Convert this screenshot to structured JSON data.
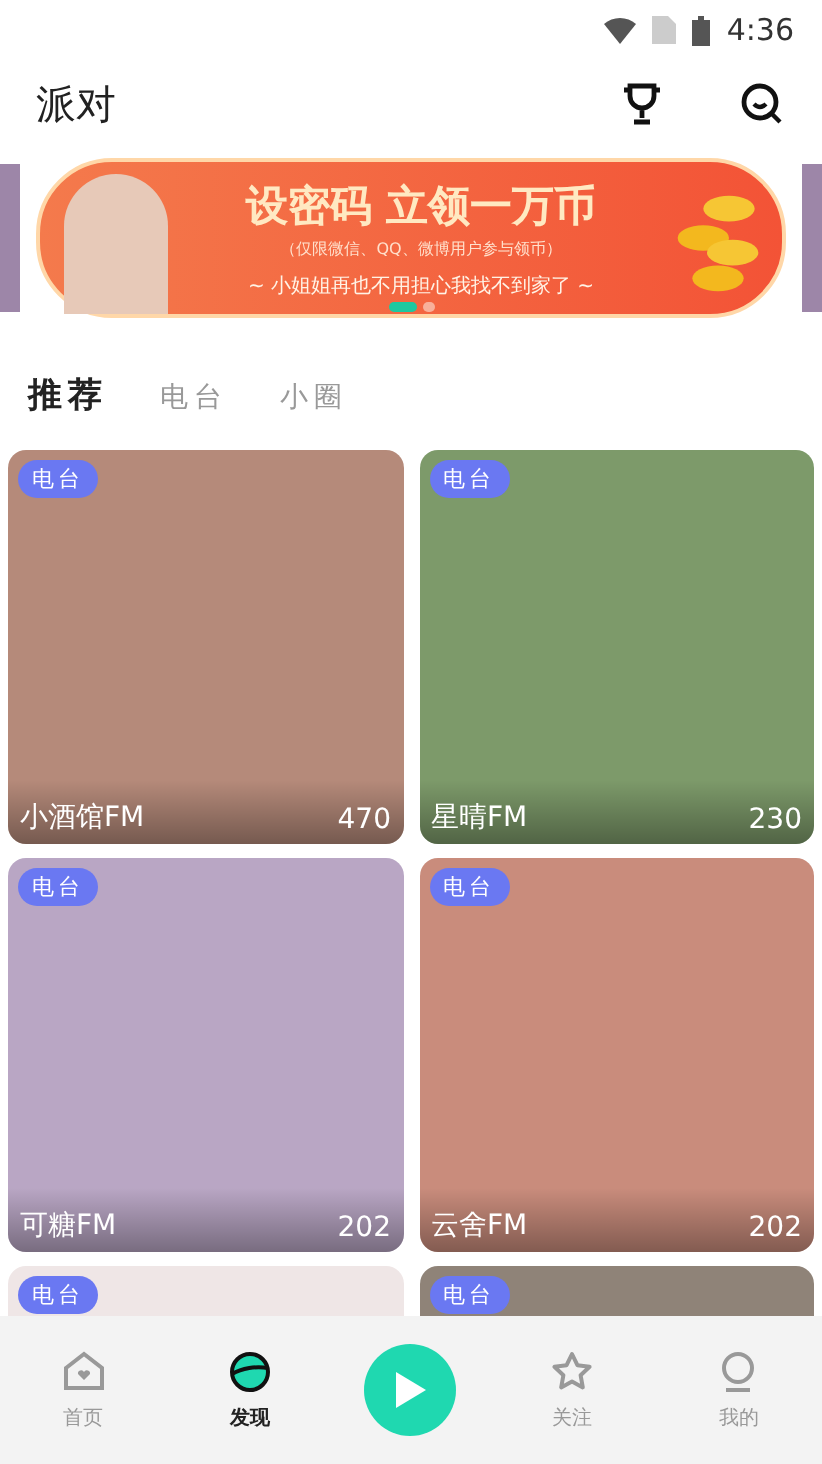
{
  "status_bar": {
    "time": "4:36"
  },
  "header": {
    "title": "派对"
  },
  "banner": {
    "headline": "设密码 立领一万币",
    "note": "（仅限微信、QQ、微博用户参与领币）",
    "slogan": "~ 小姐姐再也不用担心我找不到家了 ~",
    "pages": [
      {
        "selected": true
      },
      {
        "selected": false
      }
    ]
  },
  "tabs": [
    {
      "label": "推荐",
      "selected": true
    },
    {
      "label": "电台",
      "selected": false
    },
    {
      "label": "小圈",
      "selected": false
    }
  ],
  "cards": [
    {
      "badge": "电台",
      "name": "小酒馆FM",
      "count": "470",
      "color": "#b58a7a"
    },
    {
      "badge": "电台",
      "name": "星晴FM",
      "count": "230",
      "color": "#7d9a6a"
    },
    {
      "badge": "电台",
      "name": "可糖FM",
      "count": "202",
      "color": "#b9a6c4"
    },
    {
      "badge": "电台",
      "name": "云舍FM",
      "count": "202",
      "color": "#c98c7c"
    },
    {
      "badge": "电台",
      "color": "#efe6e6"
    },
    {
      "badge": "电台",
      "color": "#8f8378"
    }
  ],
  "nav": [
    {
      "label": "首页",
      "kind": "home",
      "selected": false
    },
    {
      "label": "发现",
      "kind": "discover",
      "selected": true
    },
    {
      "kind": "play"
    },
    {
      "label": "关注",
      "kind": "star",
      "selected": false
    },
    {
      "label": "我的",
      "kind": "me",
      "selected": false
    }
  ]
}
